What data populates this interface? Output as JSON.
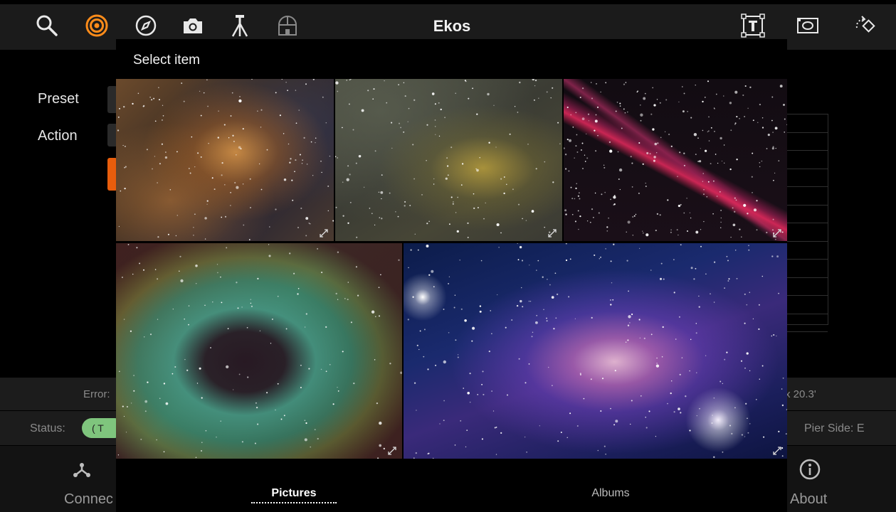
{
  "app": {
    "title": "Ekos"
  },
  "toolbar": {
    "icons": [
      "search-icon",
      "target-icon",
      "compass-icon",
      "camera-icon",
      "tripod-icon",
      "observatory-icon",
      "text-box-icon",
      "frame-icon",
      "rotate-icon"
    ],
    "accent_color": "#ff8c1a"
  },
  "form": {
    "preset_label": "Preset",
    "action_label": "Action"
  },
  "footer": {
    "error_label": "Error:",
    "error_value_fragment": "x 20.3'",
    "status_label": "Status:",
    "status_badge_fragment": "( T",
    "pier_side": "Pier Side: E"
  },
  "bottom_nav": {
    "connect_fragment": "Connec",
    "about_label": "About"
  },
  "picker": {
    "title": "Select item",
    "tabs": [
      {
        "label": "Pictures",
        "selected": true
      },
      {
        "label": "Albums",
        "selected": false
      }
    ],
    "images": [
      {
        "name": "gallery-image-1",
        "dominant": "#6b4a2c"
      },
      {
        "name": "gallery-image-2",
        "dominant": "#4c4e42"
      },
      {
        "name": "gallery-image-3",
        "dominant": "#1a0f18"
      },
      {
        "name": "gallery-image-4",
        "dominant": "#3c6f5c"
      },
      {
        "name": "gallery-image-5",
        "dominant": "#1a2a6e"
      }
    ]
  }
}
